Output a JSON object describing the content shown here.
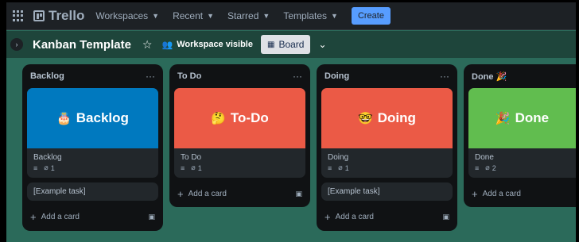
{
  "nav": {
    "app_name": "Trello",
    "items": [
      {
        "label": "Workspaces"
      },
      {
        "label": "Recent"
      },
      {
        "label": "Starred"
      },
      {
        "label": "Templates"
      }
    ],
    "create_label": "Create"
  },
  "board": {
    "title": "Kanban Template",
    "visibility": "Workspace visible",
    "view_label": "Board"
  },
  "lists": [
    {
      "title": "Backlog",
      "cover_text": "Backlog",
      "cover_color": "#0079bf",
      "card_title": "Backlog",
      "attachments": "1",
      "extra_card": "[Example task]",
      "add_label": "Add a card"
    },
    {
      "title": "To Do",
      "cover_text": "To-Do",
      "cover_color": "#eb5a46",
      "card_title": "To Do",
      "attachments": "1",
      "add_label": "Add a card"
    },
    {
      "title": "Doing",
      "cover_text": "Doing",
      "cover_color": "#eb5a46",
      "card_title": "Doing",
      "attachments": "1",
      "extra_card": "[Example task]",
      "add_label": "Add a card"
    },
    {
      "title": "Done",
      "title_emoji": "🎉",
      "cover_text": "Done",
      "cover_color": "#61bd4f",
      "card_title": "Done",
      "attachments": "2",
      "add_label": "Add a card"
    }
  ],
  "icons": {
    "apps": "apps-grid-icon",
    "star": "star-icon",
    "people": "people-icon",
    "board_view": "board-icon",
    "description": "description-icon",
    "attachment": "attachment-icon",
    "template": "template-icon"
  }
}
